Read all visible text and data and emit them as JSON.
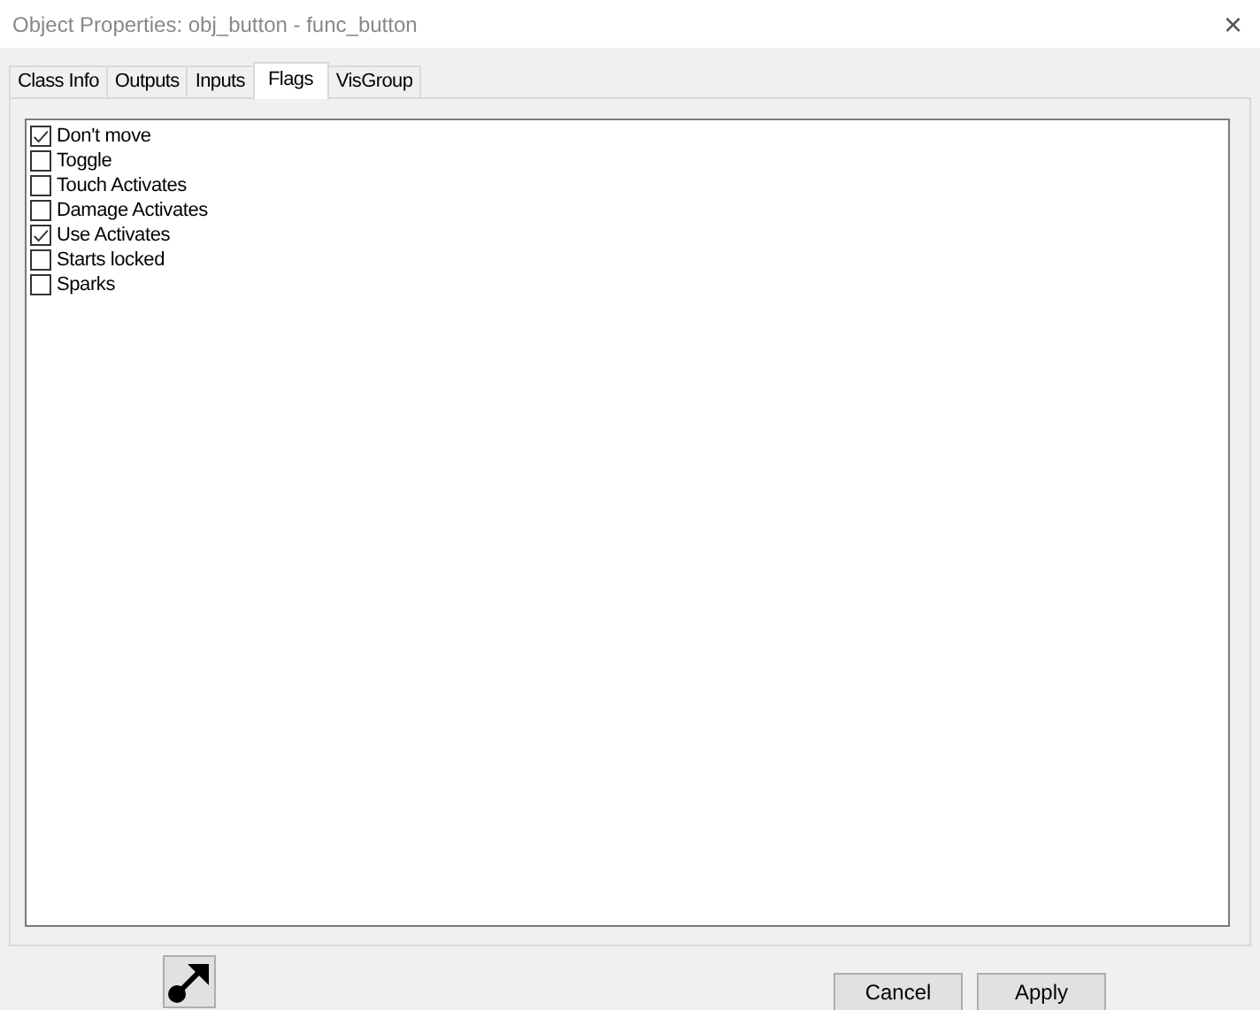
{
  "window": {
    "title": "Object Properties: obj_button - func_button",
    "close": "×"
  },
  "tabs": [
    {
      "label": "Class Info",
      "selected": false
    },
    {
      "label": "Outputs",
      "selected": false
    },
    {
      "label": "Inputs",
      "selected": false
    },
    {
      "label": "Flags",
      "selected": true
    },
    {
      "label": "VisGroup",
      "selected": false
    }
  ],
  "flags": [
    {
      "label": "Don't move",
      "checked": true
    },
    {
      "label": "Toggle",
      "checked": false
    },
    {
      "label": "Touch Activates",
      "checked": false
    },
    {
      "label": "Damage Activates",
      "checked": false
    },
    {
      "label": "Use Activates",
      "checked": true
    },
    {
      "label": "Starts locked",
      "checked": false
    },
    {
      "label": "Sparks",
      "checked": false
    }
  ],
  "buttons": [
    "Cancel",
    "Apply"
  ]
}
